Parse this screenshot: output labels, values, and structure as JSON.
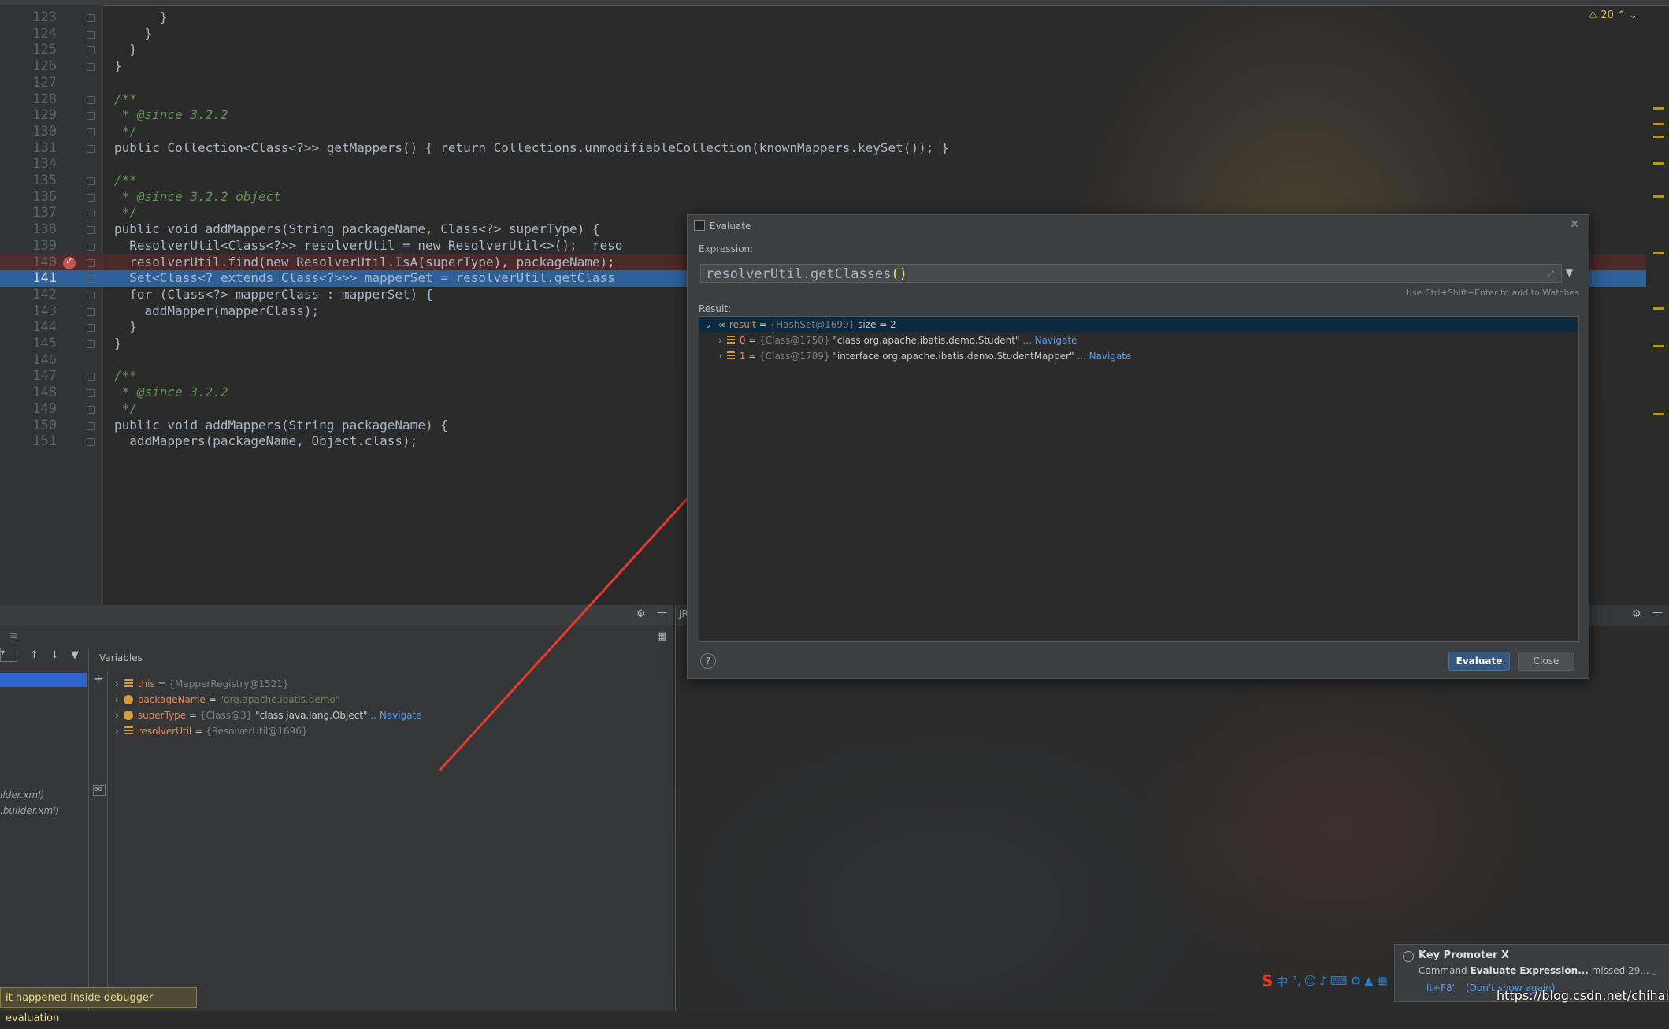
{
  "editor": {
    "warning_count": "20",
    "lines": [
      {
        "n": "123",
        "code": "      }"
      },
      {
        "n": "124",
        "code": "    }"
      },
      {
        "n": "125",
        "code": "  }"
      },
      {
        "n": "126",
        "code": "}"
      },
      {
        "n": "127",
        "code": ""
      },
      {
        "n": "128",
        "code": "/**"
      },
      {
        "n": "129",
        "code": " * @since 3.2.2"
      },
      {
        "n": "130",
        "code": " */"
      },
      {
        "n": "131",
        "code": "public Collection<Class<?>> getMappers() { return Collections.unmodifiableCollection(knownMappers.keySet()); }"
      },
      {
        "n": "134",
        "code": ""
      },
      {
        "n": "135",
        "code": "/**"
      },
      {
        "n": "136",
        "code": " * @since 3.2.2 object"
      },
      {
        "n": "137",
        "code": " */"
      },
      {
        "n": "138",
        "code": "public void addMappers(String packageName, Class<?> superType) {"
      },
      {
        "n": "139",
        "code": "  ResolverUtil<Class<?>> resolverUtil = new ResolverUtil<>();  reso"
      },
      {
        "n": "140",
        "code": "  resolverUtil.find(new ResolverUtil.IsA(superType), packageName);"
      },
      {
        "n": "141",
        "code": "  Set<Class<? extends Class<?>>> mapperSet = resolverUtil.getClass"
      },
      {
        "n": "142",
        "code": "  for (Class<?> mapperClass : mapperSet) {"
      },
      {
        "n": "143",
        "code": "    addMapper(mapperClass);"
      },
      {
        "n": "144",
        "code": "  }"
      },
      {
        "n": "145",
        "code": "}"
      },
      {
        "n": "146",
        "code": ""
      },
      {
        "n": "147",
        "code": "/**"
      },
      {
        "n": "148",
        "code": " * @since 3.2.2"
      },
      {
        "n": "149",
        "code": " */"
      },
      {
        "n": "150",
        "code": "public void addMappers(String packageName) {"
      },
      {
        "n": "151",
        "code": "  addMappers(packageName, Object.class);"
      }
    ]
  },
  "debug": {
    "variables_title": "Variables",
    "frames": [
      "ilder.xml)",
      ".builder.xml)"
    ],
    "variables": [
      {
        "name": "this",
        "eq": " = ",
        "ref": "{MapperRegistry@1521}",
        "val": "",
        "nav": ""
      },
      {
        "name": "packageName",
        "eq": " = ",
        "ref": "",
        "val": "\"org.apache.ibatis.demo\"",
        "nav": ""
      },
      {
        "name": "superType",
        "eq": " = ",
        "ref": "{Class@3}",
        "val": " \"class java.lang.Object\"",
        "nav": "... Navigate"
      },
      {
        "name": "resolverUtil",
        "eq": " = ",
        "ref": "{ResolverUtil@1696}",
        "val": "",
        "nav": ""
      }
    ],
    "right_tab": "JR"
  },
  "dialog": {
    "title": "Evaluate",
    "expression_label": "Expression:",
    "expression": "resolverUtil.getClasses",
    "expression_parens": "()",
    "hint": "Use Ctrl+Shift+Enter to add to Watches",
    "result_label": "Result:",
    "result_root": {
      "name": "result",
      "eq": " = ",
      "ref": "{HashSet@1699}",
      "size": "  size = 2"
    },
    "result_items": [
      {
        "idx": "0",
        "eq": " = ",
        "ref": "{Class@1750}",
        "val": " \"class org.apache.ibatis.demo.Student\"",
        "nav": "... Navigate"
      },
      {
        "idx": "1",
        "eq": " = ",
        "ref": "{Class@1789}",
        "val": " \"interface org.apache.ibatis.demo.StudentMapper\"",
        "nav": "... Navigate"
      }
    ],
    "help": "?",
    "evaluate_label": "Evaluate",
    "close_label": "Close"
  },
  "toast": "it happened inside debugger evaluation",
  "key_promoter": {
    "title": "Key Promoter X",
    "message_prefix": "Command ",
    "command": "Evaluate Expression...",
    "message_suffix": " missed 29...",
    "shortcut": "lt+F8'",
    "link": "(Don't show again)"
  },
  "ime": {
    "s": "S",
    "zh": "中",
    "dot": "°,"
  },
  "watermark": "https://blog.csdn.net/chihaihai",
  "colors": {
    "accent": "#2d6099",
    "breakpoint": "#c75450",
    "navigate": "#589df6"
  }
}
